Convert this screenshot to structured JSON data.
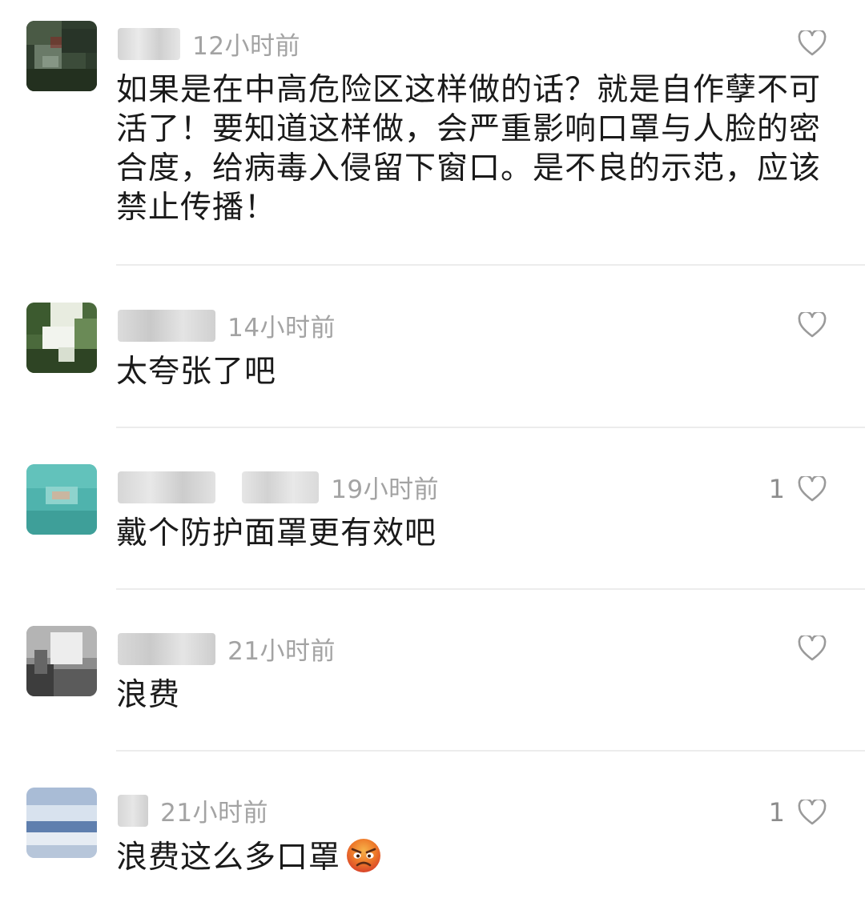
{
  "comments": [
    {
      "time": "12小时前",
      "text": "如果是在中高危险区这样做的话？就是自作孽不可活了！要知道这样做，会严重影响口罩与人脸的密合度，给病毒入侵留下窗口。是不良的示范，应该禁止传播！",
      "likes": ""
    },
    {
      "time": "14小时前",
      "text": "太夸张了吧",
      "likes": ""
    },
    {
      "time": "19小时前",
      "text": "戴个防护面罩更有效吧",
      "likes": "1"
    },
    {
      "time": "21小时前",
      "text": "浪费",
      "likes": ""
    },
    {
      "time": "21小时前",
      "text": "浪费这么多口罩",
      "likes": "1",
      "emoji": "angry-face-icon"
    }
  ],
  "colors": {
    "time": "#a3a3a3",
    "text": "#1a1a1a",
    "divider": "#ececec",
    "heart": "#9a9a9a"
  }
}
